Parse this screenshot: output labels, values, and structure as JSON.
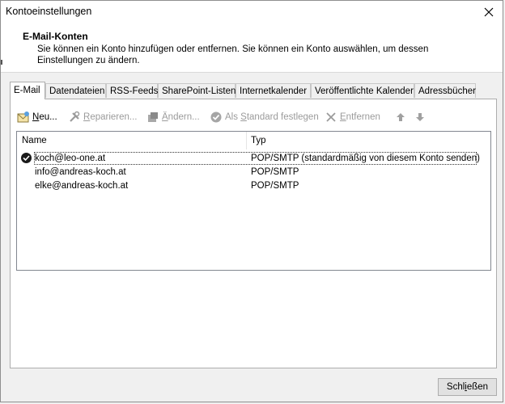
{
  "window": {
    "title": "Kontoeinstellungen"
  },
  "header": {
    "title": "E-Mail-Konten",
    "description": "Sie können ein Konto hinzufügen oder entfernen. Sie können ein Konto auswählen, um dessen Einstellungen zu ändern."
  },
  "tabs": [
    {
      "label": "E-Mail"
    },
    {
      "label": "Datendateien"
    },
    {
      "label": "RSS-Feeds"
    },
    {
      "label": "SharePoint-Listen"
    },
    {
      "label": "Internetkalender"
    },
    {
      "label": "Veröffentlichte Kalender"
    },
    {
      "label": "Adressbücher"
    }
  ],
  "toolbar": {
    "new_pre": "",
    "new_accel": "N",
    "new_post": "eu...",
    "repair_pre": "",
    "repair_accel": "R",
    "repair_post": "eparieren...",
    "change_pre": "",
    "change_accel": "Ä",
    "change_post": "ndern...",
    "default_pre": "Als ",
    "default_accel": "S",
    "default_post": "tandard festlegen",
    "remove_pre": "",
    "remove_accel": "E",
    "remove_post": "ntfernen",
    "icons": {
      "new": "mail-add-icon",
      "repair": "tools-icon",
      "change": "window-edit-icon",
      "default": "check-circle-icon",
      "remove": "x-icon",
      "up": "arrow-up-icon",
      "down": "arrow-down-icon"
    }
  },
  "list": {
    "columns": {
      "name": "Name",
      "type": "Typ"
    },
    "rows": [
      {
        "name": "koch@leo-one.at",
        "type": "POP/SMTP (standardmäßig von diesem Konto senden)"
      },
      {
        "name": "info@andreas-koch.at",
        "type": "POP/SMTP"
      },
      {
        "name": "elke@andreas-koch.at",
        "type": "POP/SMTP"
      }
    ]
  },
  "footer": {
    "close_pre": "Schl",
    "close_accel": "i",
    "close_post": "eßen"
  },
  "colors": {
    "disabled_text": "#9b9b9b",
    "panel_border": "#adadad",
    "list_border": "#828790"
  }
}
